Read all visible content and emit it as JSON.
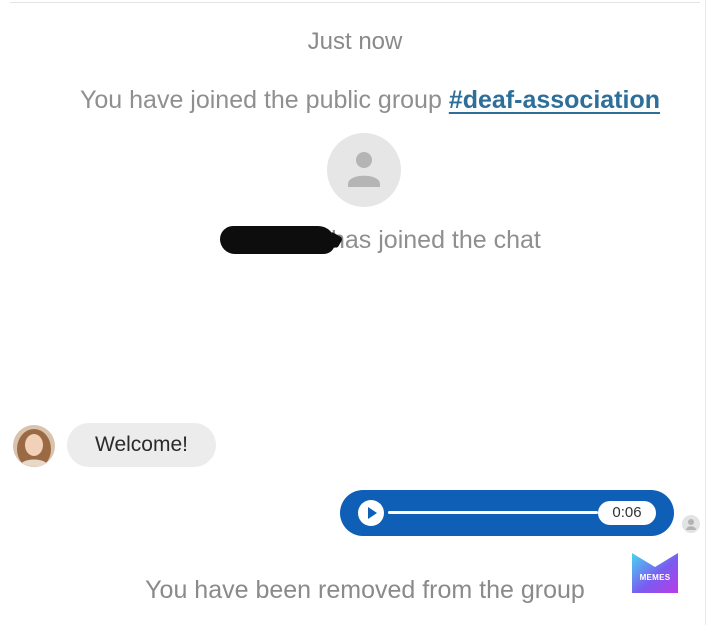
{
  "chat": {
    "timestamp": "Just now",
    "join_notice_prefix": "You have joined the public group ",
    "group_name": "#deaf-association",
    "member_joined_suffix": "has joined the chat",
    "removed_notice": "You have been removed from the group"
  },
  "messages": {
    "incoming_text": "Welcome!",
    "voice_duration": "0:06"
  },
  "watermark": {
    "label": "MEMES"
  },
  "colors": {
    "accent_blue": "#0f5fb7",
    "link_blue": "#2e6f9a",
    "bubble_gray": "#ececec",
    "notice_gray": "#8f8f8f"
  },
  "icons": {
    "large_avatar": "default-user-icon",
    "play": "play-icon",
    "receipt": "user-avatar-small-icon",
    "logo": "memes-logo-icon"
  }
}
